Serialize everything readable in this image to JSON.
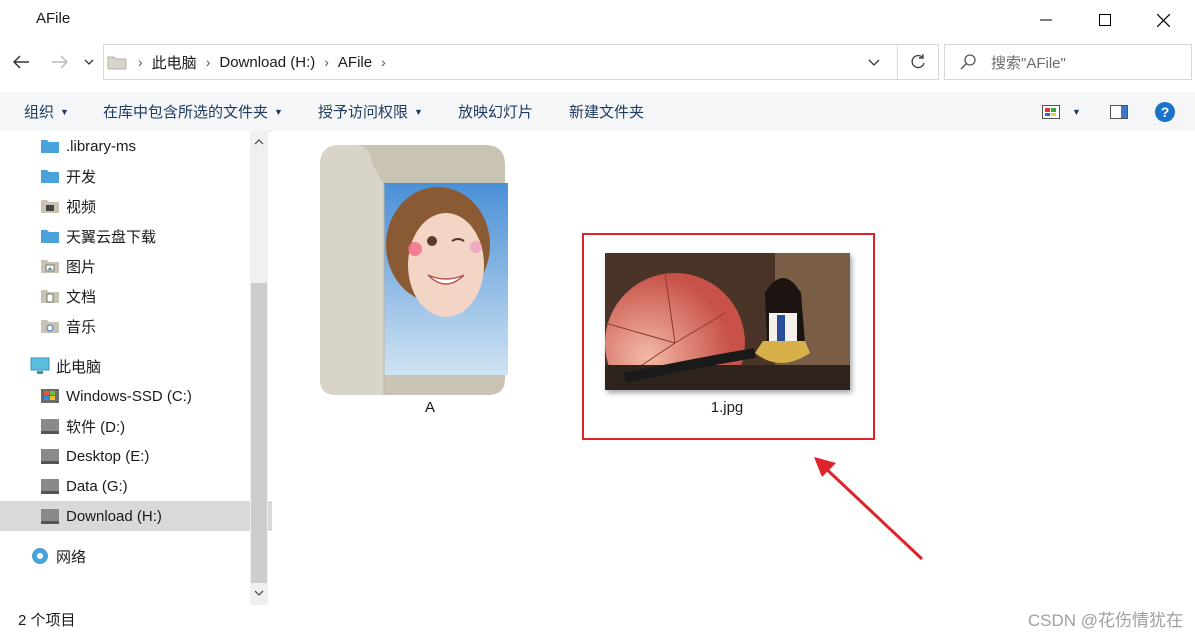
{
  "window": {
    "title": "AFile"
  },
  "address": {
    "crumbs": [
      "此电脑",
      "Download (H:)",
      "AFile"
    ]
  },
  "search": {
    "placeholder": "搜索\"AFile\""
  },
  "toolbar": {
    "organize": "组织",
    "include_in_library": "在库中包含所选的文件夹",
    "grant_access": "授予访问权限",
    "slideshow": "放映幻灯片",
    "new_folder": "新建文件夹"
  },
  "sidebar": {
    "items": [
      {
        "label": ".library-ms",
        "icon": "folder-icon"
      },
      {
        "label": "开发",
        "icon": "folder-icon"
      },
      {
        "label": "视频",
        "icon": "videos-folder-icon"
      },
      {
        "label": "天翼云盘下载",
        "icon": "folder-icon"
      },
      {
        "label": "图片",
        "icon": "pictures-folder-icon"
      },
      {
        "label": "文档",
        "icon": "documents-folder-icon"
      },
      {
        "label": "音乐",
        "icon": "music-folder-icon"
      },
      {
        "label": "此电脑",
        "icon": "computer-icon"
      },
      {
        "label": "Windows-SSD (C:)",
        "icon": "windows-drive-icon"
      },
      {
        "label": "软件 (D:)",
        "icon": "drive-icon"
      },
      {
        "label": "Desktop (E:)",
        "icon": "drive-icon"
      },
      {
        "label": "Data (G:)",
        "icon": "drive-icon"
      },
      {
        "label": "Download (H:)",
        "icon": "drive-icon",
        "selected": true
      },
      {
        "label": "网络",
        "icon": "network-icon"
      }
    ]
  },
  "files": [
    {
      "name": "A",
      "type": "folder"
    },
    {
      "name": "1.jpg",
      "type": "image"
    }
  ],
  "status": {
    "item_count": "2 个项目"
  },
  "watermark": "CSDN @花伤情犹在",
  "colors": {
    "annotation": "#e0232b",
    "folder": "#d9d4c8",
    "help": "#1a73c9"
  }
}
